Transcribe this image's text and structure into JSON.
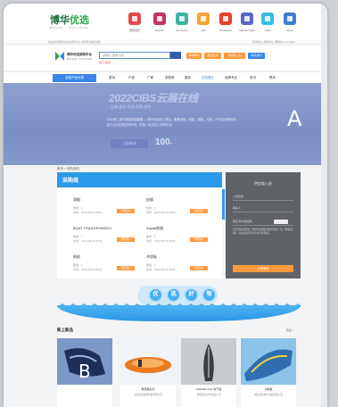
{
  "brand": {
    "logo_main": "博华",
    "logo_highlight": "优选",
    "logo_sub": "BOHUA · YOUXUAN"
  },
  "top_icons": [
    {
      "label": "国家馆区",
      "color": "#e54848",
      "icon": "flag-icon"
    },
    {
      "label": "Explore",
      "color": "#c0365e",
      "icon": "explore-icon"
    },
    {
      "label": "Sub Event",
      "color": "#3fb4a2",
      "icon": "calendar-icon"
    },
    {
      "label": "Gift",
      "color": "#f2a33a",
      "icon": "gift-icon"
    },
    {
      "label": "Wholesale",
      "color": "#e8412d",
      "icon": "store-icon"
    },
    {
      "label": "Market Trade",
      "color": "#5b67c9",
      "icon": "market-icon"
    },
    {
      "label": "Chat",
      "color": "#38bde0",
      "icon": "chat-icon"
    },
    {
      "label": "About",
      "color": "#3f7fd0",
      "icon": "about-icon"
    }
  ],
  "util_bar": {
    "left": "欢迎来到博华优选采购平台  请登录  免费注册",
    "right": "买家中心  卖家中心  帮助中心  English"
  },
  "header": {
    "site_name": "博华优选采购平台",
    "site_sub": "BOHUA · YOUXUAN",
    "search_placeholder": "请输入搜索内容",
    "hot_tags": "热门  热搜",
    "buttons": [
      {
        "label": "采购需求",
        "color": "#ff9a3d"
      },
      {
        "label": "免费发布",
        "color": "#ff9a3d"
      },
      {
        "label": "供应商入驻",
        "color": "#ff9a3d"
      },
      {
        "label": "联系我们",
        "color": "#3a86e8"
      }
    ]
  },
  "nav": {
    "category": "全部产品分类",
    "items": [
      "首页",
      "产品",
      "厂家",
      "采购商",
      "展会",
      "在线展厅",
      "品牌专区",
      "资讯",
      "联系"
    ],
    "active_index": 5
  },
  "banner": {
    "title": "2022CIBS云展在线",
    "subtitle": "云端·展会·优选·采购·合作",
    "text": "2022第二届中国国际船艇展 — 博华优选线上展会，聚焦游艇、帆船、赛艇、冲浪、户外运动等品类，助力企业拓展全球市场，打造一站式线上采购平台。",
    "button": "立即参观",
    "number": "100",
    "number_suffix": "+",
    "overlay_label": "A"
  },
  "breadcrumb": "首页 > 采购商机",
  "purchase": {
    "title": "采购商",
    "items": [
      {
        "name": "游艇",
        "qty": "数量：1",
        "date": "时间：2022-08-26 08:00",
        "btn": "我要报价"
      },
      {
        "name": "皮艇",
        "qty": "数量：1",
        "date": "时间：2022-08-26 08:00",
        "btn": "我要报价"
      },
      {
        "name": "BOAT TRAILER/WINCH",
        "qty": "数量：1",
        "date": "时间：2022-08-26 08:00",
        "btn": "我要报价"
      },
      {
        "name": "Kayak船舶",
        "qty": "数量：1",
        "date": "时间：2022-08-26 08:00",
        "btn": "我要报价"
      },
      {
        "name": "帆船",
        "qty": "数量：1",
        "date": "时间：2022-08-26 08:00",
        "btn": "我要报价"
      },
      {
        "name": "冲浪板",
        "qty": "数量：1",
        "date": "时间：2022-08-26 08:00",
        "btn": "我要报价"
      }
    ]
  },
  "supplier": {
    "title": "供应商入驻",
    "field1": "公司名称",
    "field2": "联系人",
    "field3": "联系方式/验证码",
    "note": "您已阅读并同意《博华优选用户服务协议》及《隐私政策》，提交后我们将尽快与您联系。",
    "button": "立即提交"
  },
  "youxuan": [
    "优",
    "选",
    "好",
    "物"
  ],
  "new_section": {
    "title": "新上新品",
    "more": "更多 >"
  },
  "products": [
    {
      "name": "",
      "company": "",
      "color1": "#4a6fa8",
      "color2": "#1c2f58",
      "overlay_label": "B"
    },
    {
      "name": "橡皮艇系列",
      "company": "上海某某船艇科技有限公司",
      "color1": "#f0f4f8",
      "color2": "#e97a1e"
    },
    {
      "name": "Inflatable boat 充气船",
      "company": "深圳某某户外用品公司",
      "color1": "#c9ccce",
      "color2": "#3a3f44"
    },
    {
      "name": "冲浪板",
      "company": "海南某某体育用品有限公司",
      "color1": "#2f6fb0",
      "color2": "#8dc3e8"
    }
  ]
}
